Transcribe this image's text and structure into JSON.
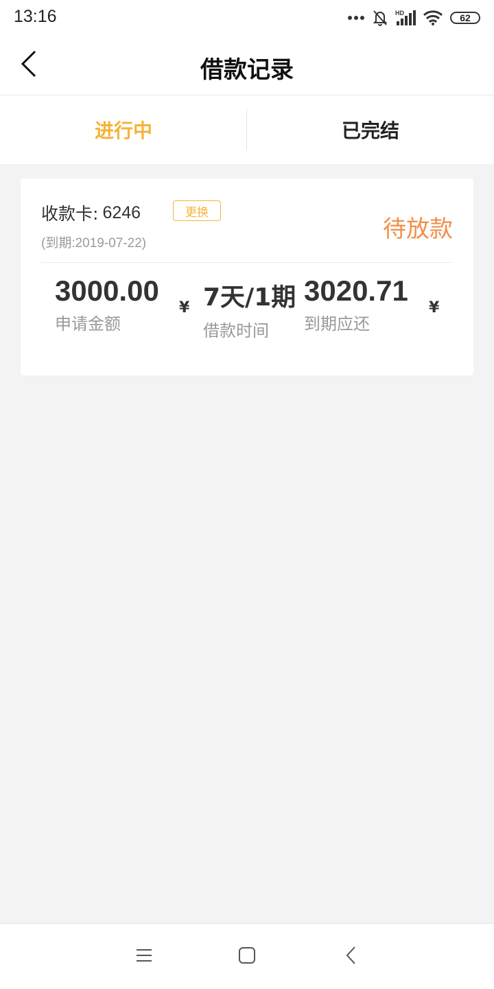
{
  "status_bar": {
    "time": "13:16",
    "battery": "62",
    "icons": [
      "more-dots-icon",
      "bell-off-icon",
      "hd-signal-icon",
      "wifi-icon",
      "battery-icon"
    ]
  },
  "header": {
    "title": "借款记录",
    "back_icon": "chevron-left-icon"
  },
  "tabs": [
    {
      "label": "进行中",
      "active": true
    },
    {
      "label": "已完结",
      "active": false
    }
  ],
  "colors": {
    "accent": "#f5b335",
    "status": "#f0904a",
    "background": "#f3f3f3"
  },
  "loan": {
    "card_label": "收款卡:",
    "card_number": "6246",
    "change_label": "更换",
    "due_date": "(到期:2019-07-22)",
    "status": "待放款",
    "amount": "3000.00",
    "amount_currency": "¥",
    "amount_label": "申请金额",
    "term": "7天/1期",
    "term_label": "借款时间",
    "repay": "3020.71",
    "repay_currency": "¥",
    "repay_label": "到期应还"
  },
  "bottom_nav": {
    "icons": [
      "menu-icon",
      "home-square-icon",
      "back-chevron-icon"
    ]
  }
}
